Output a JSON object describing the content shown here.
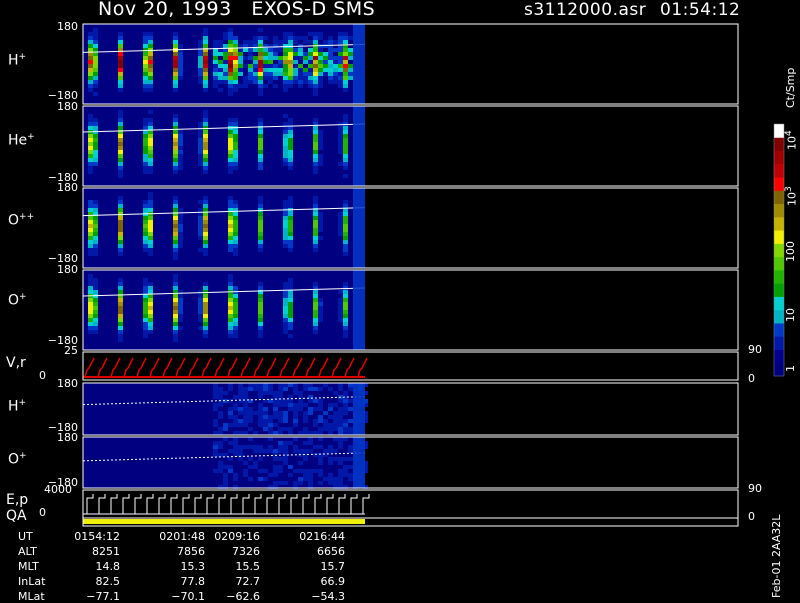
{
  "header": {
    "title": "Nov 20, 1993   EXOS-D SMS",
    "file": "s3112000.asr",
    "time": "01:54:12"
  },
  "panels": {
    "h_plus": {
      "name": "H",
      "sup": "+",
      "top": "180",
      "bottom": "−180"
    },
    "he_plus": {
      "name": "He",
      "sup": "+",
      "top": "180",
      "bottom": "−180"
    },
    "o_plusplus": {
      "name": "O",
      "sup": "++",
      "top": "180",
      "bottom": "−180"
    },
    "o_plus": {
      "name": "O",
      "sup": "+",
      "top": "180",
      "bottom": "−180"
    },
    "vr": {
      "name": "V,r",
      "top": "25",
      "bottom": "0",
      "right_top": "90",
      "right_bottom": "0"
    },
    "h_plus_2": {
      "name": "H",
      "sup": "+",
      "top": "180",
      "bottom": "−180"
    },
    "o_plus_2": {
      "name": "O",
      "sup": "+",
      "top": "180",
      "bottom": "−180"
    },
    "ep": {
      "name": "E,p",
      "top": "4000",
      "bottom": "0",
      "right_top": "90",
      "right_bottom": "0"
    },
    "qa": {
      "name": "QA",
      "right_bottom": "0"
    }
  },
  "colorbar": {
    "unit": "Ct/Smp",
    "labels": {
      "t1": "1",
      "t10": "10",
      "t100": "100",
      "t1e3_base": "10",
      "t1e3_exp": "3",
      "t1e4_base": "10",
      "t1e4_exp": "4"
    },
    "colors": [
      "#000080",
      "#00008c",
      "#0018a8",
      "#0038c8",
      "#00b4c8",
      "#00d0d0",
      "#00a000",
      "#20b400",
      "#50c800",
      "#80d800",
      "#f0f000",
      "#c8b400",
      "#a08c00",
      "#806400",
      "#ff0000",
      "#c00000",
      "#a00000",
      "#800000",
      "#ffffff"
    ]
  },
  "footer": {
    "rows": [
      {
        "name": "UT",
        "values": [
          "0154:12",
          "0201:48",
          "0209:16",
          "0216:44"
        ]
      },
      {
        "name": "ALT",
        "values": [
          "8251",
          "7856",
          "7326",
          "6656"
        ]
      },
      {
        "name": "MLT",
        "values": [
          "14.8",
          "15.3",
          "15.5",
          "15.7"
        ]
      },
      {
        "name": "InLat",
        "values": [
          "82.5",
          "77.8",
          "72.7",
          "66.9"
        ]
      },
      {
        "name": "MLat",
        "values": [
          "−77.1",
          "−70.1",
          "−62.6",
          "−54.3"
        ]
      }
    ],
    "side_note": "Feb-01 2AA32L"
  },
  "chart_data": {
    "type": "heatmap",
    "title": "Nov 20, 1993   EXOS-D SMS",
    "x_ticks": [
      "0154:12",
      "0201:48",
      "0209:16",
      "0216:44"
    ],
    "panels": [
      "H+",
      "He+",
      "O++",
      "O+",
      "V,r",
      "H+",
      "O+",
      "E,p",
      "QA"
    ],
    "ylim_pitch": [
      -180,
      180
    ],
    "vr_ylim": [
      0,
      25
    ],
    "ep_ylim": [
      0,
      4000
    ],
    "colorbar_range": [
      1,
      10000
    ],
    "colorbar_unit": "Ct/Smp",
    "log_scale_colorbar": true
  }
}
